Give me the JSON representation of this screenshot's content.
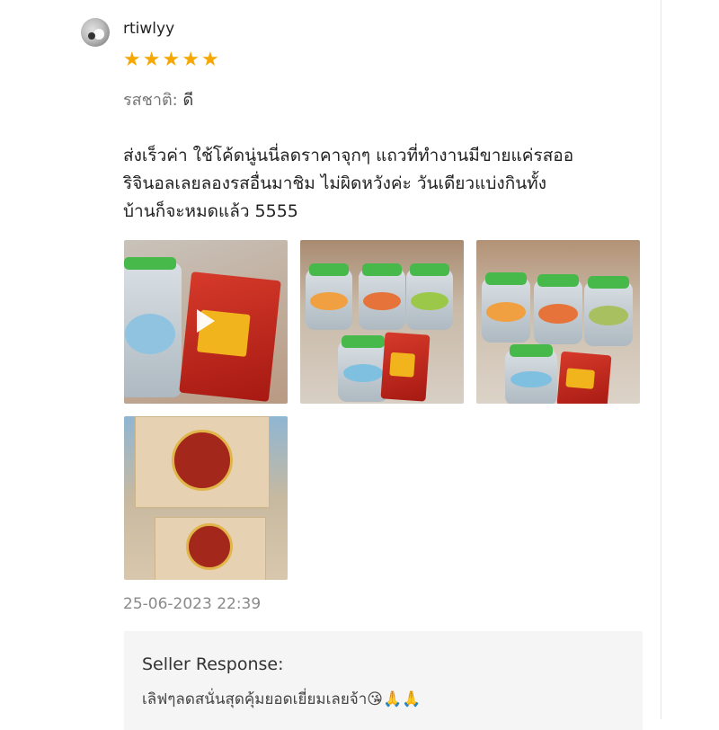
{
  "review": {
    "username": "rtiwlyy",
    "rating": 5,
    "stars": [
      "★",
      "★",
      "★",
      "★",
      "★"
    ],
    "star_color": "#f6a700",
    "attribute_label": "รสชาติ:",
    "attribute_value": "ดี",
    "text_lines": [
      "ส่งเร็วค่า ใช้โค้ดนู่นนี่ลดราคาจุกๆ แถวที่ทำงานมีขายแค่รสออ",
      "ริจินอลเลยลองรสอื่นมาชิม ไม่ผิดหวังค่ะ วันเดียวแบ่งกินทั้ง",
      "บ้านก็จะหมดแล้ว 5555"
    ],
    "media": [
      {
        "type": "video",
        "icon": "play-icon"
      },
      {
        "type": "image"
      },
      {
        "type": "image"
      },
      {
        "type": "image"
      }
    ],
    "datetime": "25-06-2023 22:39"
  },
  "seller_response": {
    "title": "Seller Response:",
    "text": "เลิฟๆลดสนั่นสุดคุ้มยอดเยี่ยมเลยจ้า😘🙏🙏"
  }
}
